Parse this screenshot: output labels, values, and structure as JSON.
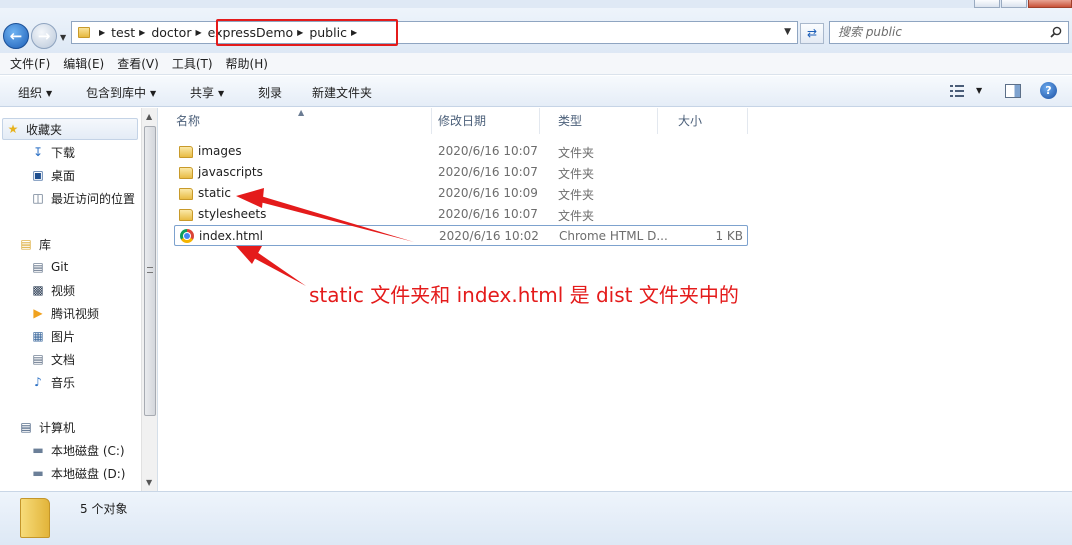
{
  "address": {
    "crumbs": [
      "test",
      "doctor",
      "expressDemo",
      "public"
    ],
    "search_placeholder": "搜索 public"
  },
  "menubar": [
    "文件(F)",
    "编辑(E)",
    "查看(V)",
    "工具(T)",
    "帮助(H)"
  ],
  "commands": {
    "organize": "组织",
    "include_library": "包含到库中",
    "share": "共享",
    "burn": "刻录",
    "new_folder": "新建文件夹"
  },
  "nav": {
    "favorites": "收藏夹",
    "favorites_items": [
      "下载",
      "桌面",
      "最近访问的位置"
    ],
    "libraries": "库",
    "library_items": [
      "Git",
      "视频",
      "腾讯视频",
      "图片",
      "文档",
      "音乐"
    ],
    "computer": "计算机",
    "drives": [
      "本地磁盘 (C:)",
      "本地磁盘 (D:)"
    ]
  },
  "columns": {
    "name": "名称",
    "modified": "修改日期",
    "type": "类型",
    "size": "大小"
  },
  "files": [
    {
      "name": "images",
      "modified": "2020/6/16 10:07",
      "type": "文件夹",
      "size": "",
      "icon": "folder-icon"
    },
    {
      "name": "javascripts",
      "modified": "2020/6/16 10:07",
      "type": "文件夹",
      "size": "",
      "icon": "folder-icon"
    },
    {
      "name": "static",
      "modified": "2020/6/16 10:09",
      "type": "文件夹",
      "size": "",
      "icon": "folder-icon"
    },
    {
      "name": "stylesheets",
      "modified": "2020/6/16 10:07",
      "type": "文件夹",
      "size": "",
      "icon": "folder-icon"
    },
    {
      "name": "index.html",
      "modified": "2020/6/16 10:02",
      "type": "Chrome HTML D...",
      "size": "1 KB",
      "icon": "chrome-icon"
    }
  ],
  "annotation": "static 文件夹和 index.html 是 dist 文件夹中的",
  "status": {
    "count": "5 个对象"
  },
  "colors": {
    "annotation": "#e41b1b",
    "selection_border": "#7da2ce"
  }
}
